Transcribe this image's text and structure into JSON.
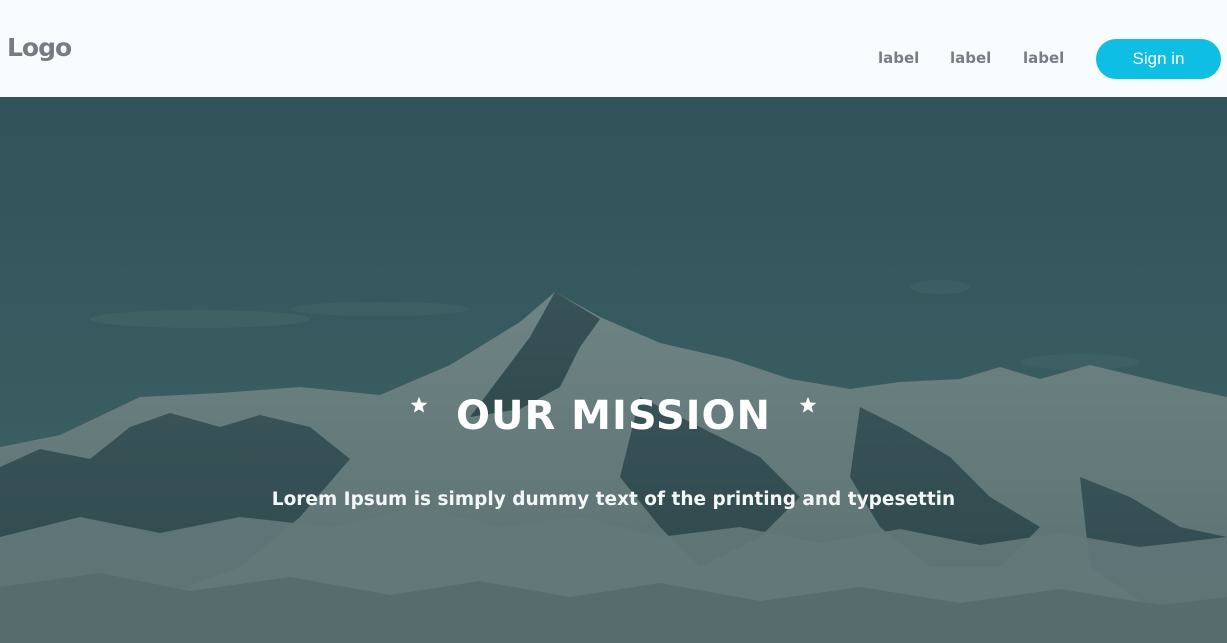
{
  "header": {
    "logo_text": "Logo",
    "nav": [
      {
        "label": "label"
      },
      {
        "label": "label"
      },
      {
        "label": "label"
      }
    ],
    "signin_label": "Sign in"
  },
  "hero": {
    "title": "OUR MISSION",
    "subtitle": "Lorem Ipsum is simply dummy text of the printing and typesettin",
    "star_icon": "star-icon"
  },
  "colors": {
    "header_bg": "#f7fcff",
    "accent": "#0fbee3",
    "nav_text": "#767d86",
    "hero_tint": "#3b5e63"
  }
}
